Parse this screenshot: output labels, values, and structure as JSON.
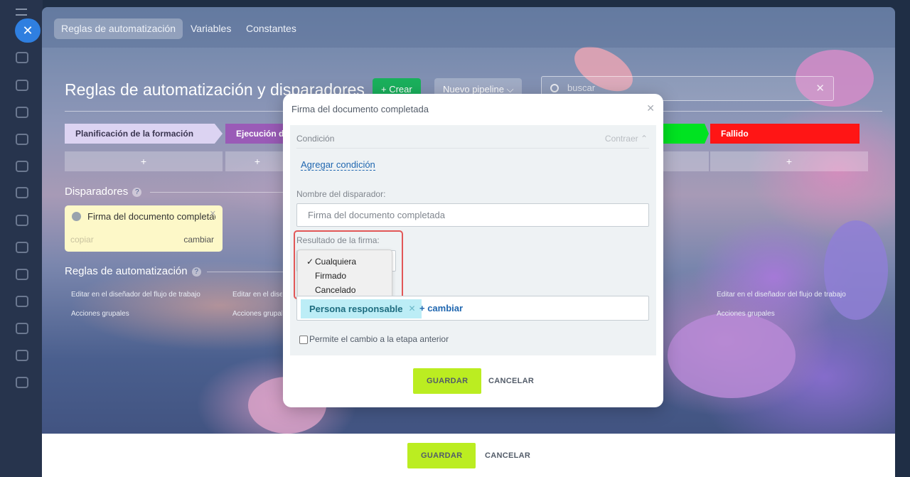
{
  "slider_tabs": [
    "Reglas de automatización",
    "Variables",
    "Constantes"
  ],
  "page": {
    "title": "Reglas de automatización y disparadores",
    "create_label": "+ Crear",
    "pipeline_label": "Nuevo pipeline ⌵",
    "search_placeholder": "buscar"
  },
  "stages": [
    {
      "label": "Planificación de la formación",
      "color": "#dcd3f2"
    },
    {
      "label": "Ejecución de la formación",
      "color": "#9a5bb7"
    },
    {
      "label": "",
      "color": "#00e321"
    },
    {
      "label": "Fallido",
      "color": "#ff1515"
    }
  ],
  "add_symbol": "+",
  "triggers": {
    "section_title": "Disparadores",
    "card": {
      "title": "Firma del documento completada",
      "copy": "copiar",
      "change": "cambiar"
    }
  },
  "rules": {
    "section_title": "Reglas de automatización",
    "edit_label": "Editar en el diseñador del flujo de trabajo",
    "group_label": "Acciones grupales"
  },
  "footer": {
    "save": "GUARDAR",
    "cancel": "CANCELAR"
  },
  "dialog": {
    "title": "Firma del documento completada",
    "condition_label": "Condición",
    "collapse_label": "Contraer ⌃",
    "add_condition": "Agregar condición",
    "trigger_name_label": "Nombre del disparador:",
    "trigger_name_placeholder": "Firma del documento completada",
    "sign_result_label": "Resultado de la firma:",
    "options": [
      "Cualquiera",
      "Firmado",
      "Cancelado"
    ],
    "selected_option": "Cualquiera",
    "responsible_chip": "Persona responsable",
    "responsible_change": "+ cambiar",
    "allow_back_label": "Permite el cambio a la etapa anterior",
    "save": "GUARDAR",
    "cancel": "CANCELAR"
  },
  "colors": {
    "accent_green": "#bbed21",
    "link_blue": "#2067b0",
    "highlight_red": "#e25757"
  }
}
